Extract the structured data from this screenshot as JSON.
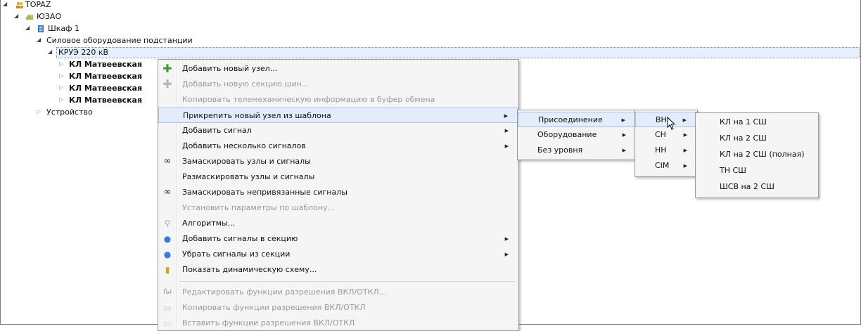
{
  "tree": {
    "root": "TOPAZ",
    "region": "ЮЗАО",
    "cabinet": "Шкаф 1",
    "group": "Силовое оборудование подстанции",
    "selected": "КРУЭ 220 кВ",
    "children": [
      "КЛ Матвеевская",
      "КЛ Матвеевская",
      "КЛ Матвеевская",
      "КЛ Матвеевская"
    ],
    "device": "Устройство"
  },
  "context_menu": {
    "items": [
      {
        "label": "Добавить новый узел...",
        "icon": "plus-green-icon"
      },
      {
        "label": "Добавить новую секцию шин...",
        "icon": "plus-gray-icon"
      },
      {
        "label": "Копировать телемеханическую информацию в буфер обмена"
      },
      {
        "label": "Прикрепить новый узел из шаблона"
      },
      {
        "label": "Добавить сигнал"
      },
      {
        "label": "Добавить несколько сигналов"
      },
      {
        "label": "Замаскировать узлы и сигналы",
        "icon": "mask-icon"
      },
      {
        "label": "Размаскировать узлы и сигналы"
      },
      {
        "label": "Замаскировать непривязанные сигналы",
        "icon": "mask-icon"
      },
      {
        "label": "Установить параметры по шаблону..."
      },
      {
        "label": "Алгоритмы...",
        "icon": "algorithm-icon"
      },
      {
        "label": "Добавить сигналы в секцию",
        "icon": "signals-add-icon"
      },
      {
        "label": "Убрать сигналы из секции",
        "icon": "signals-remove-icon"
      },
      {
        "label": "Показать динамическую схему...",
        "icon": "scheme-icon"
      },
      {
        "label": "Редактировать функции разрешения ВКЛ/ОТКЛ...",
        "icon": "function-icon"
      },
      {
        "label": "Копировать функции разрешения ВКЛ/ОТКЛ",
        "icon": "copy-icon"
      },
      {
        "label": "Вставить функции разрешения ВКЛ/ОТКЛ",
        "icon": "paste-icon"
      }
    ]
  },
  "submenu_template": [
    "Присоединение",
    "Оборудование",
    "Без уровня"
  ],
  "submenu_levels": [
    "ВН",
    "СН",
    "НН",
    "CIM"
  ],
  "submenu_vn": [
    "КЛ на 1 СШ",
    "КЛ на 2 СШ",
    "КЛ на 2 СШ (полная)",
    "ТН СШ",
    "ШСВ на 2 СШ"
  ],
  "colors": {
    "menu_bg": "#f5f5f5",
    "highlight": "#e3ecfb",
    "disabled": "#9a9a9a"
  }
}
